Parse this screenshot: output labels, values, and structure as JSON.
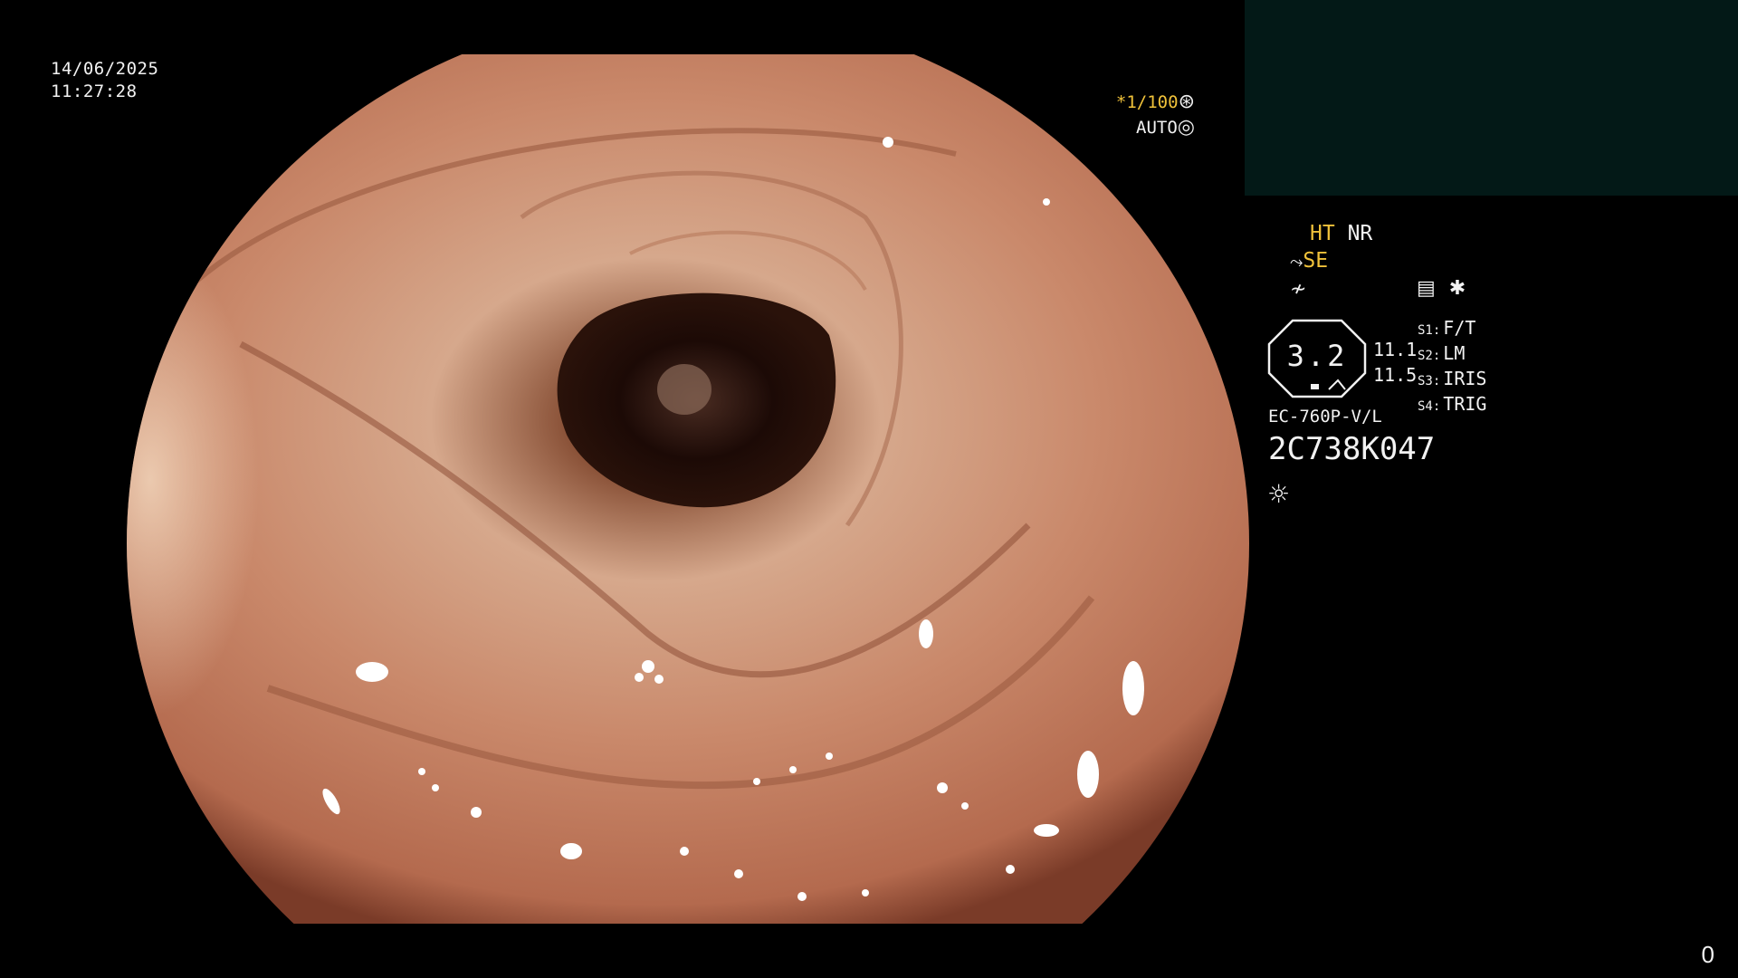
{
  "overlay": {
    "date": "14/06/2025",
    "time": "11:27:28",
    "shutter": "*1/100",
    "iris_mode": "AUTO",
    "mode_1_yellow": "HT",
    "mode_1_white": "NR",
    "mode_2": "SE",
    "gauge_value": "3.2",
    "gauge_side_top": "11.1",
    "gauge_side_bottom": "11.5",
    "switches": [
      {
        "key": "S1:",
        "value": "F/T"
      },
      {
        "key": "S2:",
        "value": "LM"
      },
      {
        "key": "S3:",
        "value": "IRIS"
      },
      {
        "key": "S4:",
        "value": "TRIG"
      }
    ],
    "scope_model": "EC-760P-V/L",
    "scope_serial": "2C738K047",
    "counter": "0"
  },
  "colors": {
    "panel": "#031917",
    "accent_yellow": "#f0c23a",
    "mucosa": "#c9886a",
    "lumen": "#140806"
  },
  "icons": {
    "shutter": "aperture-icon",
    "iris": "iris-icon",
    "scope": "scope-icon",
    "enhance": "enhance-icon",
    "record": "record-icon",
    "light": "light-icon"
  }
}
